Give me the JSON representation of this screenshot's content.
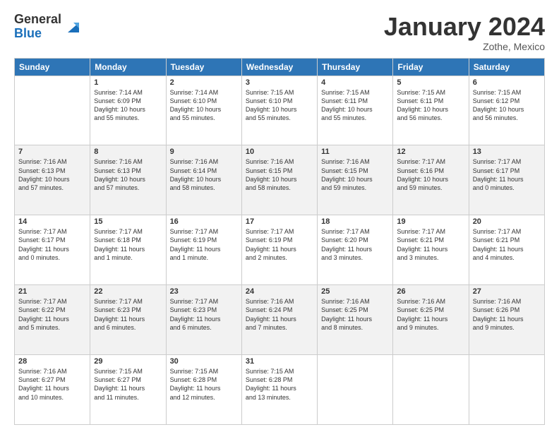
{
  "header": {
    "logo_general": "General",
    "logo_blue": "Blue",
    "month_title": "January 2024",
    "location": "Zothe, Mexico"
  },
  "days_of_week": [
    "Sunday",
    "Monday",
    "Tuesday",
    "Wednesday",
    "Thursday",
    "Friday",
    "Saturday"
  ],
  "weeks": [
    [
      {
        "day": "",
        "info": ""
      },
      {
        "day": "1",
        "info": "Sunrise: 7:14 AM\nSunset: 6:09 PM\nDaylight: 10 hours\nand 55 minutes."
      },
      {
        "day": "2",
        "info": "Sunrise: 7:14 AM\nSunset: 6:10 PM\nDaylight: 10 hours\nand 55 minutes."
      },
      {
        "day": "3",
        "info": "Sunrise: 7:15 AM\nSunset: 6:10 PM\nDaylight: 10 hours\nand 55 minutes."
      },
      {
        "day": "4",
        "info": "Sunrise: 7:15 AM\nSunset: 6:11 PM\nDaylight: 10 hours\nand 55 minutes."
      },
      {
        "day": "5",
        "info": "Sunrise: 7:15 AM\nSunset: 6:11 PM\nDaylight: 10 hours\nand 56 minutes."
      },
      {
        "day": "6",
        "info": "Sunrise: 7:15 AM\nSunset: 6:12 PM\nDaylight: 10 hours\nand 56 minutes."
      }
    ],
    [
      {
        "day": "7",
        "info": "Sunrise: 7:16 AM\nSunset: 6:13 PM\nDaylight: 10 hours\nand 57 minutes."
      },
      {
        "day": "8",
        "info": "Sunrise: 7:16 AM\nSunset: 6:13 PM\nDaylight: 10 hours\nand 57 minutes."
      },
      {
        "day": "9",
        "info": "Sunrise: 7:16 AM\nSunset: 6:14 PM\nDaylight: 10 hours\nand 58 minutes."
      },
      {
        "day": "10",
        "info": "Sunrise: 7:16 AM\nSunset: 6:15 PM\nDaylight: 10 hours\nand 58 minutes."
      },
      {
        "day": "11",
        "info": "Sunrise: 7:16 AM\nSunset: 6:15 PM\nDaylight: 10 hours\nand 59 minutes."
      },
      {
        "day": "12",
        "info": "Sunrise: 7:17 AM\nSunset: 6:16 PM\nDaylight: 10 hours\nand 59 minutes."
      },
      {
        "day": "13",
        "info": "Sunrise: 7:17 AM\nSunset: 6:17 PM\nDaylight: 11 hours\nand 0 minutes."
      }
    ],
    [
      {
        "day": "14",
        "info": "Sunrise: 7:17 AM\nSunset: 6:17 PM\nDaylight: 11 hours\nand 0 minutes."
      },
      {
        "day": "15",
        "info": "Sunrise: 7:17 AM\nSunset: 6:18 PM\nDaylight: 11 hours\nand 1 minute."
      },
      {
        "day": "16",
        "info": "Sunrise: 7:17 AM\nSunset: 6:19 PM\nDaylight: 11 hours\nand 1 minute."
      },
      {
        "day": "17",
        "info": "Sunrise: 7:17 AM\nSunset: 6:19 PM\nDaylight: 11 hours\nand 2 minutes."
      },
      {
        "day": "18",
        "info": "Sunrise: 7:17 AM\nSunset: 6:20 PM\nDaylight: 11 hours\nand 3 minutes."
      },
      {
        "day": "19",
        "info": "Sunrise: 7:17 AM\nSunset: 6:21 PM\nDaylight: 11 hours\nand 3 minutes."
      },
      {
        "day": "20",
        "info": "Sunrise: 7:17 AM\nSunset: 6:21 PM\nDaylight: 11 hours\nand 4 minutes."
      }
    ],
    [
      {
        "day": "21",
        "info": "Sunrise: 7:17 AM\nSunset: 6:22 PM\nDaylight: 11 hours\nand 5 minutes."
      },
      {
        "day": "22",
        "info": "Sunrise: 7:17 AM\nSunset: 6:23 PM\nDaylight: 11 hours\nand 6 minutes."
      },
      {
        "day": "23",
        "info": "Sunrise: 7:17 AM\nSunset: 6:23 PM\nDaylight: 11 hours\nand 6 minutes."
      },
      {
        "day": "24",
        "info": "Sunrise: 7:16 AM\nSunset: 6:24 PM\nDaylight: 11 hours\nand 7 minutes."
      },
      {
        "day": "25",
        "info": "Sunrise: 7:16 AM\nSunset: 6:25 PM\nDaylight: 11 hours\nand 8 minutes."
      },
      {
        "day": "26",
        "info": "Sunrise: 7:16 AM\nSunset: 6:25 PM\nDaylight: 11 hours\nand 9 minutes."
      },
      {
        "day": "27",
        "info": "Sunrise: 7:16 AM\nSunset: 6:26 PM\nDaylight: 11 hours\nand 9 minutes."
      }
    ],
    [
      {
        "day": "28",
        "info": "Sunrise: 7:16 AM\nSunset: 6:27 PM\nDaylight: 11 hours\nand 10 minutes."
      },
      {
        "day": "29",
        "info": "Sunrise: 7:15 AM\nSunset: 6:27 PM\nDaylight: 11 hours\nand 11 minutes."
      },
      {
        "day": "30",
        "info": "Sunrise: 7:15 AM\nSunset: 6:28 PM\nDaylight: 11 hours\nand 12 minutes."
      },
      {
        "day": "31",
        "info": "Sunrise: 7:15 AM\nSunset: 6:28 PM\nDaylight: 11 hours\nand 13 minutes."
      },
      {
        "day": "",
        "info": ""
      },
      {
        "day": "",
        "info": ""
      },
      {
        "day": "",
        "info": ""
      }
    ]
  ]
}
